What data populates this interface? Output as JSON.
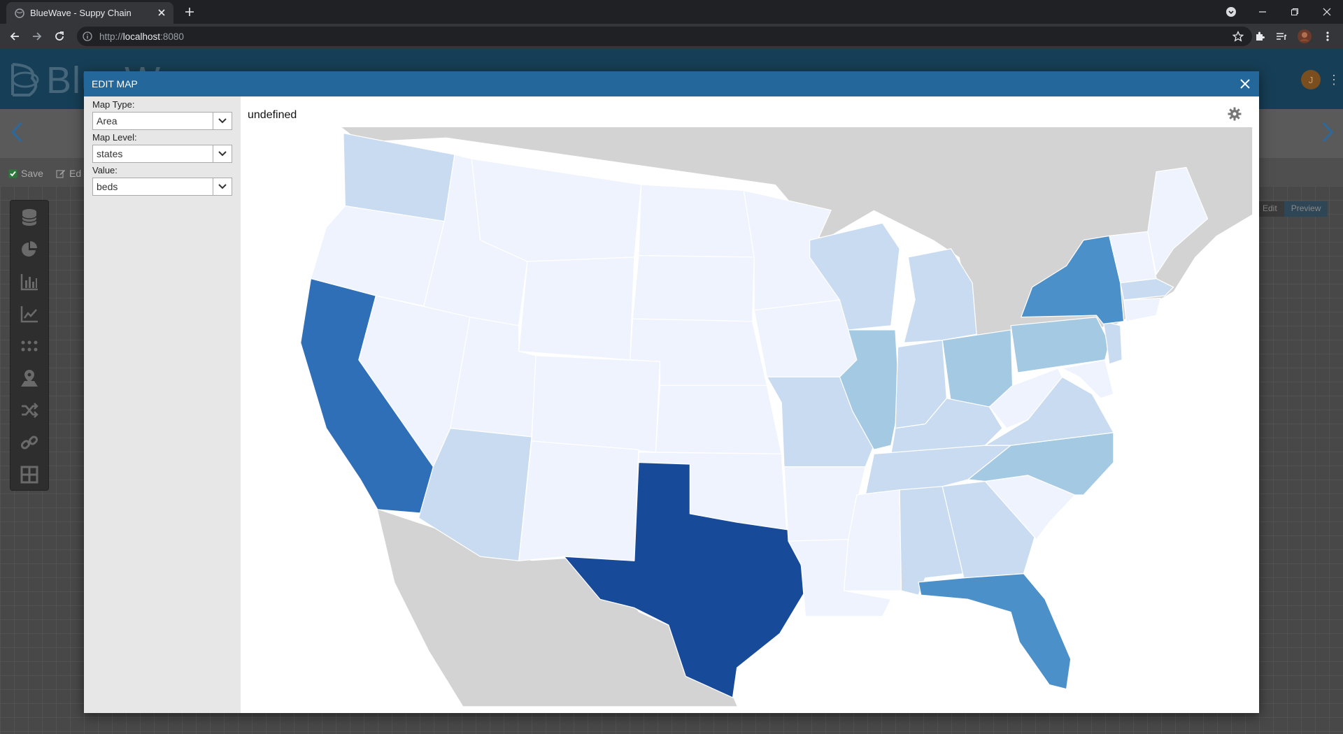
{
  "browser": {
    "tab_title": "BlueWave - Suppy Chain",
    "url_prefix": "http://",
    "url_host": "localhost",
    "url_port": ":8080"
  },
  "app": {
    "brand": "BlueW",
    "avatar_initial": "J",
    "save_label": "Save",
    "edit_label": "Ed",
    "toggle": {
      "edit": "Edit",
      "preview": "Preview"
    }
  },
  "modal": {
    "title": "EDIT MAP",
    "fields": {
      "map_type": {
        "label": "Map Type:",
        "value": "Area"
      },
      "map_level": {
        "label": "Map Level:",
        "value": "states"
      },
      "value": {
        "label": "Value:",
        "value": "beds"
      }
    },
    "map": {
      "title": "undefined",
      "colors": {
        "background_land": "#d3d3d3",
        "water": "#ffffff",
        "scale": [
          "#eef3fd",
          "#c9dbf0",
          "#a3c9e3",
          "#4b90c9",
          "#2f6fb8",
          "#184a9a"
        ]
      },
      "state_levels": {
        "Texas": 5,
        "California": 4,
        "New York": 3,
        "Florida": 3,
        "Pennsylvania": 2,
        "Ohio": 2,
        "Illinois": 2,
        "North Carolina": 2,
        "Washington": 1,
        "Arizona": 1,
        "Wisconsin": 1,
        "Michigan": 1,
        "Missouri": 1,
        "Indiana": 1,
        "Kentucky": 1,
        "Tennessee": 1,
        "Virginia": 1,
        "Georgia": 1,
        "Alabama": 1,
        "New Jersey": 1,
        "Massachusetts": 1
      }
    }
  }
}
